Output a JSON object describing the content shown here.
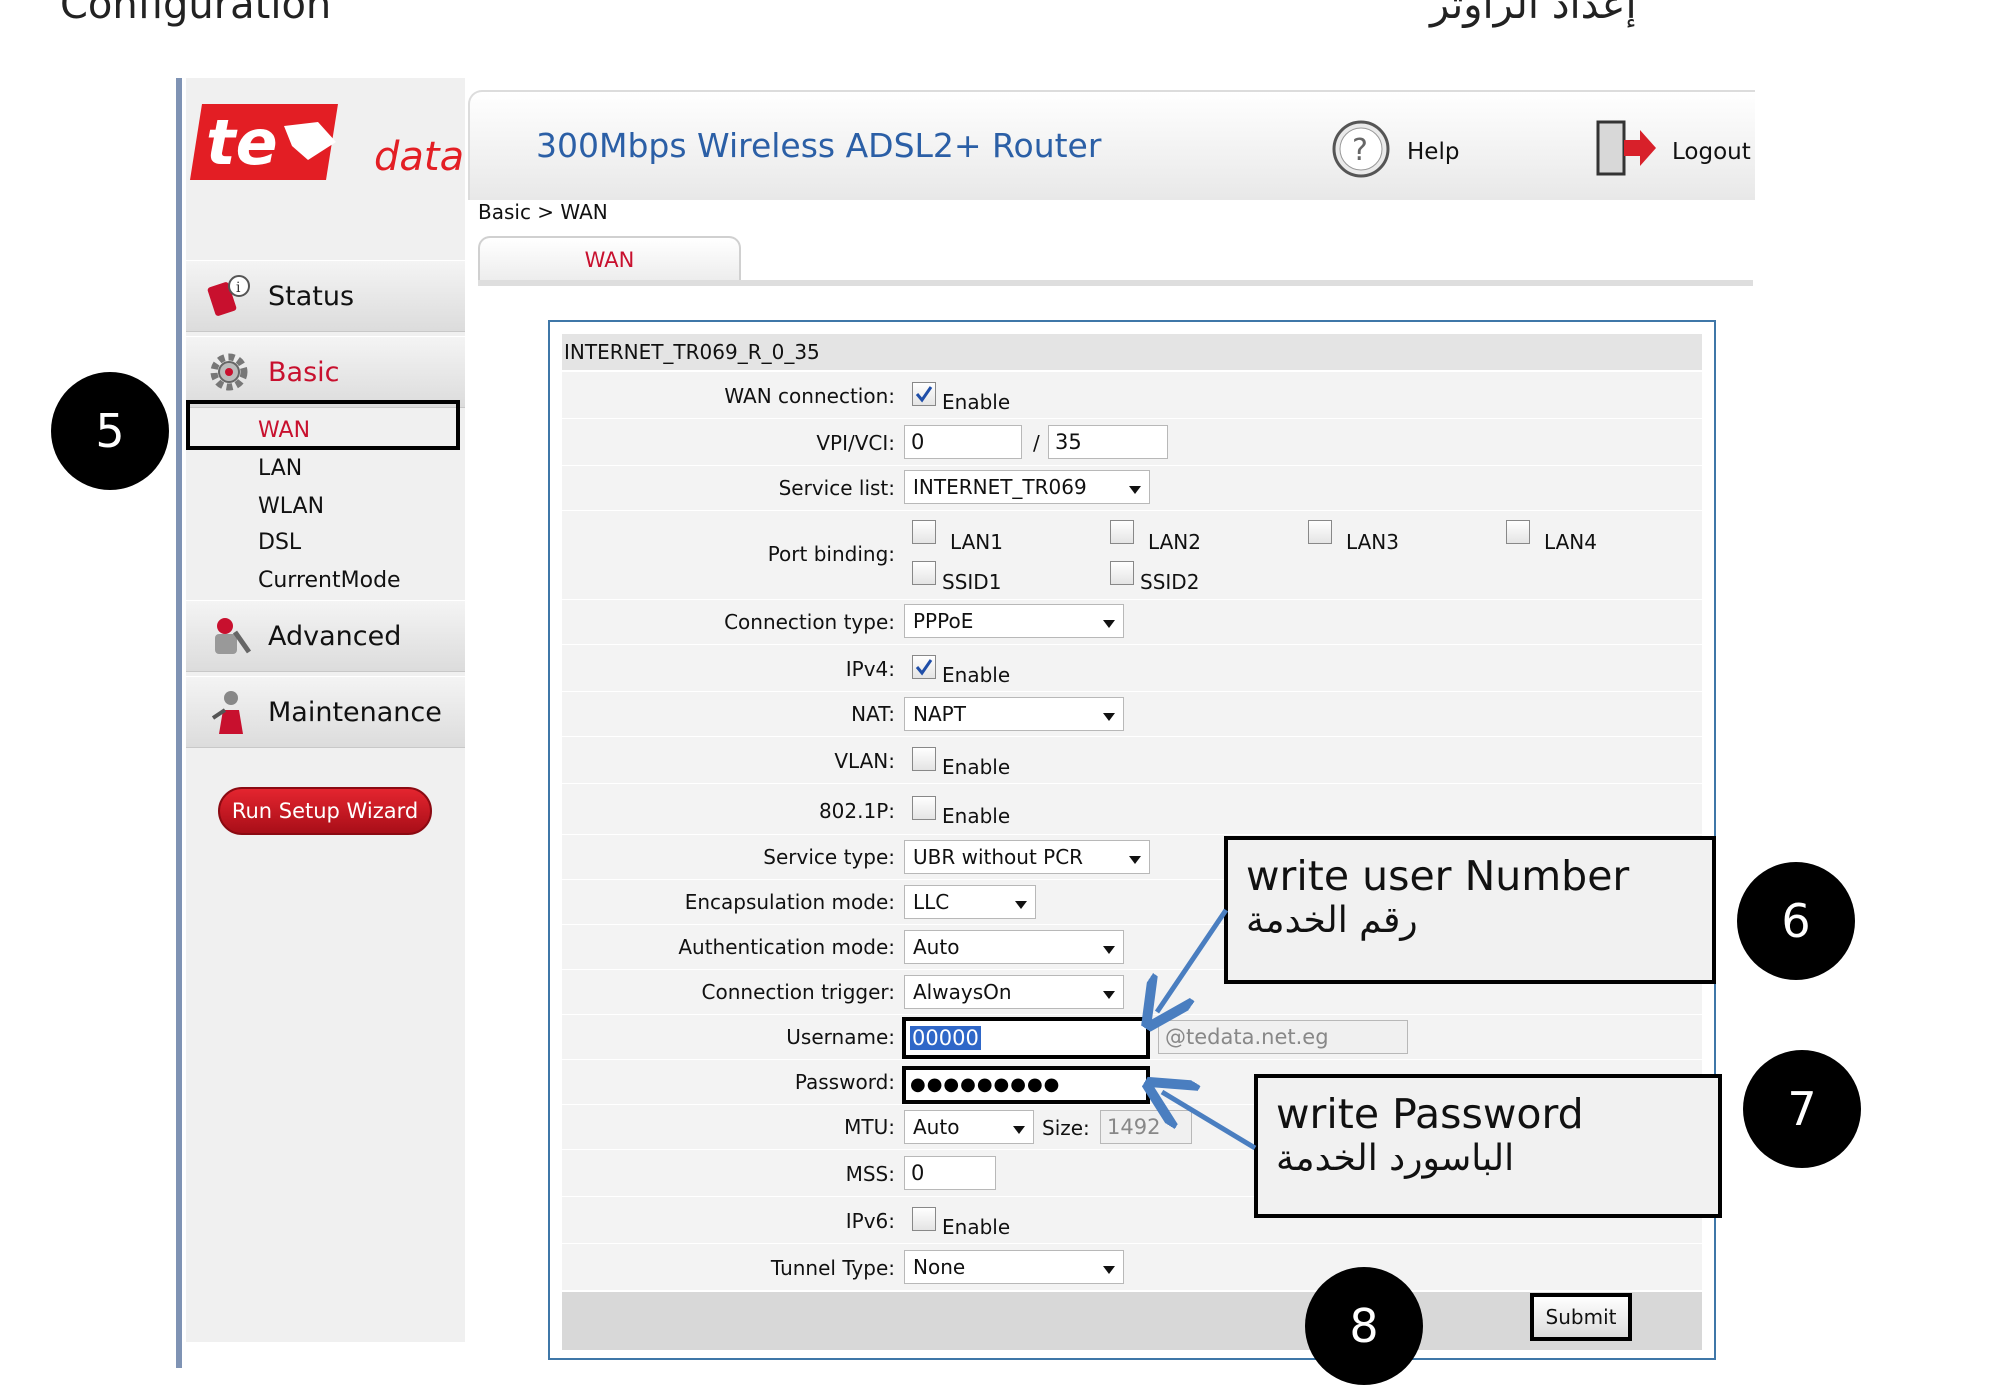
{
  "page_top": {
    "left_text": "Configuration",
    "right_text": "إعداد الراوتر"
  },
  "logo": {
    "text_main": "te",
    "text_sub": "data",
    "brand_color": "#e31e24"
  },
  "header": {
    "title": "300Mbps Wireless ADSL2+ Router",
    "help_label": "Help",
    "logout_label": "Logout"
  },
  "breadcrumb": "Basic > WAN",
  "tab": {
    "label": "WAN"
  },
  "sidebar": {
    "status": "Status",
    "basic": "Basic",
    "sub_items": [
      "WAN",
      "LAN",
      "WLAN",
      "DSL",
      "CurrentMode"
    ],
    "advanced": "Advanced",
    "maintenance": "Maintenance",
    "wizard": "Run Setup Wizard"
  },
  "form": {
    "title": "INTERNET_TR069_R_0_35",
    "wan_connection": {
      "label": "WAN connection:",
      "text": "Enable",
      "checked": true
    },
    "vpi_vci": {
      "label": "VPI/VCI:",
      "vpi": "0",
      "sep": "/",
      "vci": "35"
    },
    "service_list": {
      "label": "Service list:",
      "value": "INTERNET_TR069"
    },
    "port_binding": {
      "label": "Port binding:",
      "options": [
        "LAN1",
        "LAN2",
        "LAN3",
        "LAN4",
        "SSID1",
        "SSID2"
      ]
    },
    "connection_type": {
      "label": "Connection type:",
      "value": "PPPoE"
    },
    "ipv4": {
      "label": "IPv4:",
      "text": "Enable",
      "checked": true
    },
    "nat": {
      "label": "NAT:",
      "value": "NAPT"
    },
    "vlan": {
      "label": "VLAN:",
      "text": "Enable",
      "checked": false
    },
    "p8021p": {
      "label": "802.1P:",
      "text": "Enable",
      "checked": false
    },
    "service_type": {
      "label": "Service type:",
      "value": "UBR without PCR"
    },
    "encapsulation_mode": {
      "label": "Encapsulation mode:",
      "value": "LLC"
    },
    "authentication_mode": {
      "label": "Authentication mode:",
      "value": "Auto"
    },
    "connection_trigger": {
      "label": "Connection trigger:",
      "value": "AlwaysOn"
    },
    "username": {
      "label": "Username:",
      "value": "00000",
      "suffix": "@tedata.net.eg"
    },
    "password": {
      "label": "Password:",
      "value": "●●●●●●●●●"
    },
    "mtu": {
      "label": "MTU:",
      "value": "Auto",
      "size_label": "Size:",
      "size_value": "1492"
    },
    "mss": {
      "label": "MSS:",
      "value": "0"
    },
    "ipv6": {
      "label": "IPv6:",
      "text": "Enable",
      "checked": false
    },
    "tunnel_type": {
      "label": "Tunnel Type:",
      "value": "None"
    },
    "submit": "Submit"
  },
  "annotations": {
    "note_username": {
      "en": "write user Number",
      "ar": "رقم الخدمة"
    },
    "note_password": {
      "en": "write Password",
      "ar": "الباسورد الخدمة"
    },
    "markers": [
      "5",
      "6",
      "7",
      "8"
    ],
    "arrow_color": "#4a7ec0"
  }
}
